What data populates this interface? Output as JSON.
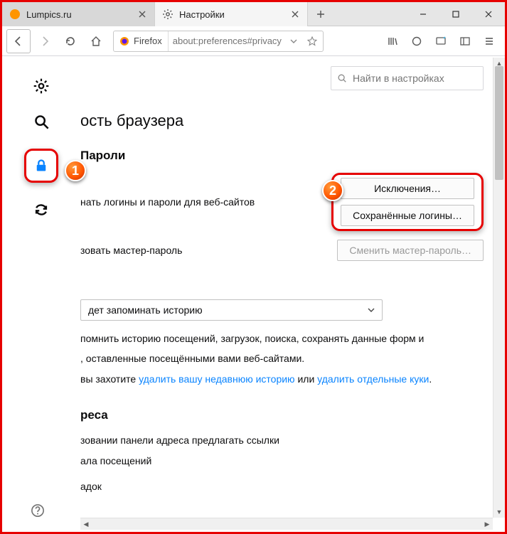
{
  "tabs": [
    {
      "title": "Lumpics.ru",
      "favicon_color": "#ff9500"
    },
    {
      "title": "Настройки"
    }
  ],
  "url": {
    "identity_label": "Firefox",
    "text": "about:preferences#privacy"
  },
  "search": {
    "placeholder": "Найти в настройках"
  },
  "page_title_fragment": "ость браузера",
  "passwords": {
    "heading": "Пароли",
    "row1_fragment": "нать логины и пароли для веб-сайтов",
    "row2_fragment": "зовать мастер-пароль",
    "btn_exceptions": "Исключения…",
    "btn_saved_logins": "Сохранённые логины…",
    "btn_change_master": "Сменить мастер-пароль…"
  },
  "history": {
    "select_value_fragment": "дет запоминать историю",
    "para1_fragment": "помнить историю посещений, загрузок, поиска, сохранять данные форм и",
    "para2_fragment": ", оставленные посещёнными вами веб-сайтами.",
    "para3_prefix": "вы захотите ",
    "link_clear_history": "удалить вашу недавнюю историю",
    "para3_mid": " или ",
    "link_clear_cookies": "удалить отдельные куки",
    "para3_end": "."
  },
  "addressbar": {
    "heading_fragment": "реса",
    "line1_fragment": "зовании панели адреса предлагать ссылки",
    "line2_fragment": "ала посещений",
    "line3_fragment": "адок"
  },
  "callouts": {
    "one": "1",
    "two": "2"
  }
}
